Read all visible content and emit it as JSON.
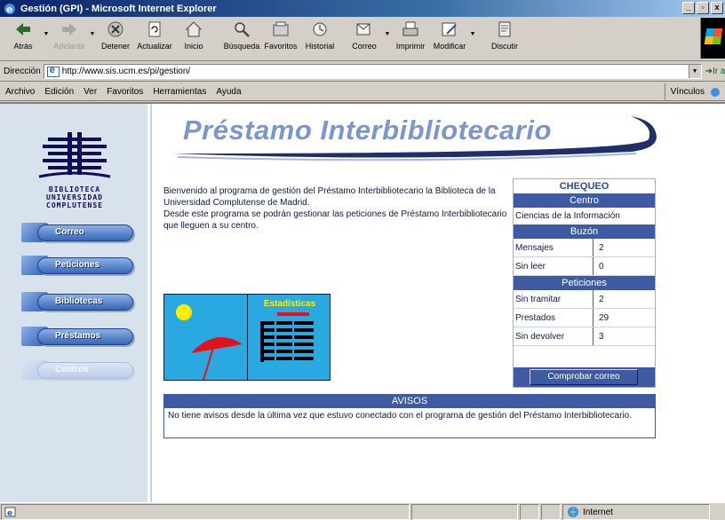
{
  "window": {
    "title": "Gestión (GPI) - Microsoft Internet Explorer",
    "controls": [
      "_",
      "▫",
      "x"
    ]
  },
  "toolbar": {
    "buttons": [
      {
        "label": "Atrás",
        "icon": "back-arrow-icon",
        "enabled": true
      },
      {
        "label": "Adelante",
        "icon": "forward-arrow-icon",
        "enabled": false
      },
      {
        "label": "Detener",
        "icon": "stop-icon",
        "enabled": true
      },
      {
        "label": "Actualizar",
        "icon": "refresh-icon",
        "enabled": true
      },
      {
        "label": "Inicio",
        "icon": "home-icon",
        "enabled": true
      },
      {
        "label": "Búsqueda",
        "icon": "search-icon",
        "enabled": true
      },
      {
        "label": "Favoritos",
        "icon": "favorites-icon",
        "enabled": true
      },
      {
        "label": "Historial",
        "icon": "history-icon",
        "enabled": true
      },
      {
        "label": "Correo",
        "icon": "mail-icon",
        "enabled": true
      },
      {
        "label": "Imprimir",
        "icon": "print-icon",
        "enabled": true
      },
      {
        "label": "Modificar",
        "icon": "edit-icon",
        "enabled": true
      },
      {
        "label": "Discutir",
        "icon": "discuss-icon",
        "enabled": true
      }
    ]
  },
  "address": {
    "label": "Dirección",
    "url": "http://www.sis.ucm.es/pi/gestion/",
    "go_label": "Ir a"
  },
  "menu": {
    "items": [
      "Archivo",
      "Edición",
      "Ver",
      "Favoritos",
      "Herramientas",
      "Ayuda"
    ],
    "links_label": "Vínculos"
  },
  "sidebar": {
    "logo_lines": [
      "BIBLIOTECA",
      "UNIVERSIDAD",
      "COMPLUTENSE"
    ],
    "nav": [
      {
        "label": "Correo",
        "active": true
      },
      {
        "label": "Peticiones",
        "active": true
      },
      {
        "label": "Bibliotecas",
        "active": true
      },
      {
        "label": "Préstamos",
        "active": true
      },
      {
        "label": "Centros",
        "active": false
      }
    ]
  },
  "main": {
    "banner_title": "Préstamo Interbibliotecario",
    "welcome_p1": "Bienvenido al programa de gestión del Préstamo Interbibliotecario la Biblioteca de la Universidad Complutense de Madrid.",
    "welcome_p2": "Desde este programa se podrán gestionar las peticiones de Préstamo Interbibliotecario que lleguen a su centro.",
    "stats_label": "Estadísticas"
  },
  "chequeo": {
    "title": "CHEQUEO",
    "centro_header": "Centro",
    "centro_value": "Ciencias de la Información",
    "buzon_header": "Buzón",
    "buzon_rows": [
      {
        "label": "Mensajes",
        "value": "2"
      },
      {
        "label": "Sin leer",
        "value": "0"
      }
    ],
    "peticiones_header": "Peticiones",
    "peticiones_rows": [
      {
        "label": "Sin tramitar",
        "value": "2"
      },
      {
        "label": "Prestados",
        "value": "29"
      },
      {
        "label": "Sin devolver",
        "value": "3"
      }
    ],
    "button_label": "Comprobar correo"
  },
  "avisos": {
    "header": "AVISOS",
    "text": "No tiene avisos desde la última vez que estuvo conectado con el programa de gestión del Préstamo Interbibliotecario."
  },
  "status": {
    "zone": "Internet"
  },
  "colors": {
    "accent": "#3e5aa3",
    "banner_text": "#7b96cc",
    "sidebar_bg": "#d7e2ec",
    "stats_bg": "#29a9e0"
  }
}
